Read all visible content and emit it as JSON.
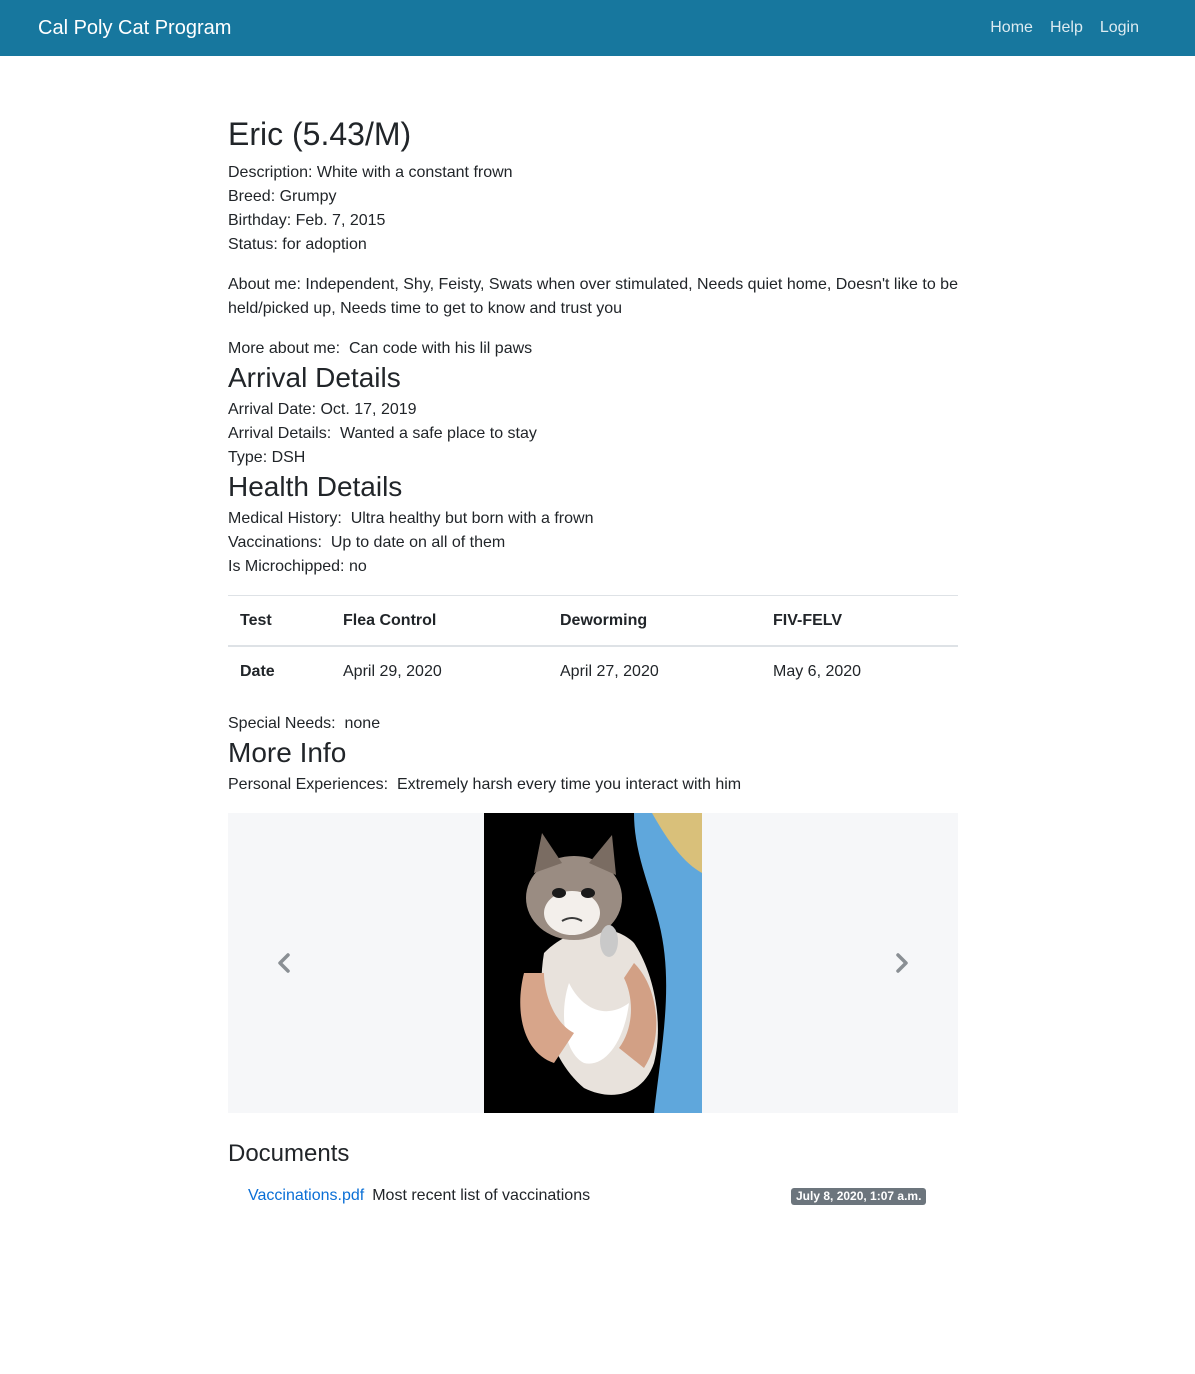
{
  "nav": {
    "brand": "Cal Poly Cat Program",
    "links": [
      "Home",
      "Help",
      "Login"
    ]
  },
  "cat": {
    "title": "Eric (5.43/M)",
    "description": "Description: White with a constant frown",
    "breed": "Breed: Grumpy",
    "birthday": "Birthday: Feb. 7, 2015",
    "status": "Status: for adoption",
    "about": "About me: Independent, Shy, Feisty, Swats when over stimulated, Needs quiet home, Doesn't like to be held/picked up, Needs time to get to know and trust you",
    "more_about": "More about me:  Can code with his lil paws"
  },
  "arrival": {
    "heading": "Arrival Details",
    "date": "Arrival Date: Oct. 17, 2019",
    "details": "Arrival Details:  Wanted a safe place to stay",
    "type": "Type: DSH"
  },
  "health": {
    "heading": "Health Details",
    "medical_history": "Medical History:  Ultra healthy but born with a frown",
    "vaccinations": "Vaccinations:  Up to date on all of them",
    "microchipped": "Is Microchipped: no",
    "table": {
      "headers": [
        "Test",
        "Flea Control",
        "Deworming",
        "FIV-FELV"
      ],
      "row": [
        "Date",
        "April 29, 2020",
        "April 27, 2020",
        "May 6, 2020"
      ]
    },
    "special_needs": "Special Needs:  none"
  },
  "more_info": {
    "heading": "More Info",
    "personal_experiences": "Personal Experiences:  Extremely harsh every time you interact with him"
  },
  "carousel": {
    "image_alt": "grumpy-cat-photo",
    "prev_icon": "chevron-left-icon",
    "next_icon": "chevron-right-icon"
  },
  "documents": {
    "heading": "Documents",
    "items": [
      {
        "name": "Vaccinations.pdf",
        "description": "Most recent list of vaccinations",
        "timestamp": "July 8, 2020, 1:07 a.m."
      }
    ]
  }
}
